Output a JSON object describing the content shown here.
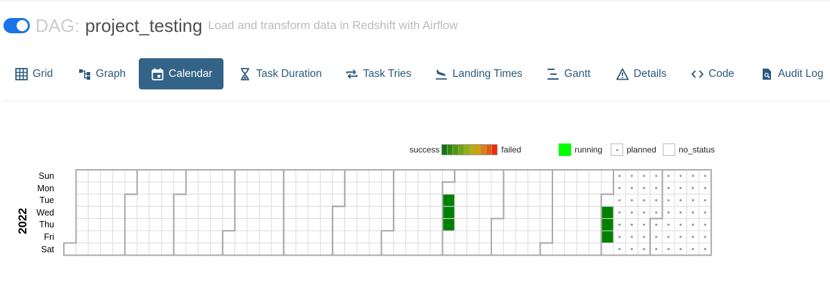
{
  "header": {
    "toggle_on": true,
    "prefix": "DAG:",
    "dag_id": "project_testing",
    "description": "Load and transform data in Redshift with Airflow"
  },
  "nav": {
    "tabs": [
      {
        "label": "Grid",
        "icon": "grid-icon",
        "active": false
      },
      {
        "label": "Graph",
        "icon": "graph-icon",
        "active": false
      },
      {
        "label": "Calendar",
        "icon": "calendar-icon",
        "active": true
      },
      {
        "label": "Task Duration",
        "icon": "hourglass-icon",
        "active": false
      },
      {
        "label": "Task Tries",
        "icon": "retry-icon",
        "active": false
      },
      {
        "label": "Landing Times",
        "icon": "plane-landing-icon",
        "active": false
      },
      {
        "label": "Gantt",
        "icon": "gantt-icon",
        "active": false
      },
      {
        "label": "Details",
        "icon": "warning-triangle-icon",
        "active": false
      },
      {
        "label": "Code",
        "icon": "code-icon",
        "active": false
      },
      {
        "label": "Audit Log",
        "icon": "audit-log-icon",
        "active": false
      }
    ]
  },
  "calendar": {
    "legend": {
      "success_label": "success",
      "failed_label": "failed",
      "running_label": "running",
      "planned_label": "planned",
      "no_status_label": "no_status",
      "gradient_colors": [
        "#0a7a0a",
        "#2e8b0a",
        "#4a990a",
        "#6fa50a",
        "#94b00a",
        "#b8b00a",
        "#d4a00a",
        "#e07f0a",
        "#e85a0a",
        "#f02a0a"
      ],
      "running_color": "#00ff00"
    },
    "year": "2022",
    "days": [
      "Sun",
      "Mon",
      "Tue",
      "Wed",
      "Thu",
      "Fri",
      "Sat"
    ],
    "colors": {
      "success": "#008000",
      "border": "#dddddd",
      "month_border": "#aaaaaa",
      "planned_dot": "#999999"
    },
    "success_dates": [
      "2022-08-02",
      "2022-08-03",
      "2022-08-04",
      "2022-11-02",
      "2022-11-03",
      "2022-11-04"
    ],
    "planned_from": "2022-11-06",
    "planned_to": "2022-12-31"
  }
}
